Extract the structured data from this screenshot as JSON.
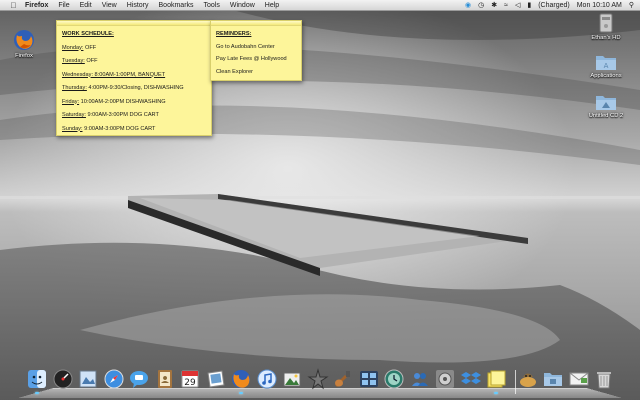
{
  "menubar": {
    "apple_icon": "apple-icon",
    "items": [
      "Firefox",
      "File",
      "Edit",
      "View",
      "History",
      "Bookmarks",
      "Tools",
      "Window",
      "Help"
    ],
    "status": {
      "battery_text": "(Charged)",
      "clock": "Mon 10:10 AM"
    }
  },
  "sticky_work": {
    "heading": "WORK SCHEDULE:",
    "rows": [
      {
        "day": "Monday:",
        "detail": " OFF"
      },
      {
        "day": "Tuesday:",
        "detail": " OFF"
      },
      {
        "day": "Wednesday:",
        "detail": " 8:00AM-1:00PM, BANQUET"
      },
      {
        "day": "Thursday:",
        "detail": " 4:00PM-9:30/Closing, DISHWASHING"
      },
      {
        "day": "Friday:",
        "detail": " 10:00AM-2:00PM DISHWASHING"
      },
      {
        "day": "Saturday:",
        "detail": " 9:00AM-3:00PM DOG CART"
      },
      {
        "day": "Sunday:",
        "detail": " 9:00AM-3:00PM DOG CART"
      }
    ]
  },
  "sticky_reminders": {
    "heading": "REMINDERS:",
    "items": [
      "Go to Audobahn Center",
      "Pay Late Fees @ Hollywood",
      "Clean Explorer"
    ]
  },
  "desktop_icons": {
    "firefox": "Firefox",
    "hd": "Ethan's HD",
    "applications": "Applications",
    "cd": "Untitled CD 2"
  },
  "dock": {
    "items": [
      "finder-icon",
      "dashboard-icon",
      "preview-icon",
      "safari-icon",
      "ichat-icon",
      "address-book-icon",
      "ical-icon",
      "photo-icon",
      "firefox-icon",
      "itunes-icon",
      "iphoto-icon",
      "imovie-icon",
      "garageband-icon",
      "spaces-icon",
      "time-machine-icon",
      "users-icon",
      "system-preferences-icon",
      "dropbox-icon",
      "stickies-icon",
      "downloads-stack-icon",
      "documents-folder-icon",
      "mail-folder-icon",
      "trash-icon"
    ],
    "running": [
      "finder-icon",
      "firefox-icon",
      "stickies-icon"
    ]
  }
}
